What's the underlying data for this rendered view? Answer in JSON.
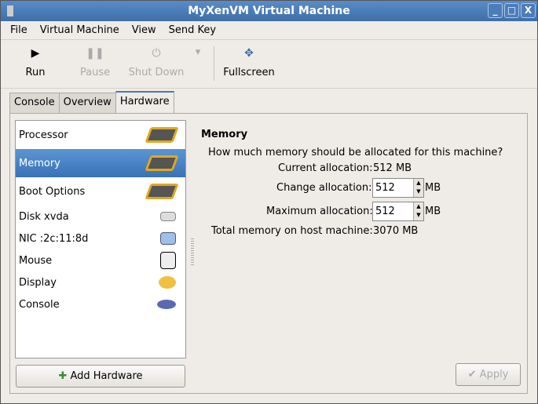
{
  "window": {
    "title": "MyXenVM Virtual Machine",
    "minimize": "_",
    "maximize": "□",
    "close": "X"
  },
  "menu": [
    "File",
    "Virtual Machine",
    "View",
    "Send Key"
  ],
  "toolbar": {
    "run": "Run",
    "pause": "Pause",
    "shutdown": "Shut Down",
    "fullscreen": "Fullscreen"
  },
  "tabs": [
    "Console",
    "Overview",
    "Hardware"
  ],
  "hardware": [
    {
      "label": "Processor",
      "icon": "chip-icon"
    },
    {
      "label": "Memory",
      "icon": "chip-icon"
    },
    {
      "label": "Boot Options",
      "icon": "chip-icon"
    },
    {
      "label": "Disk xvda",
      "icon": "disk-icon"
    },
    {
      "label": "NIC :2c:11:8d",
      "icon": "network-icon"
    },
    {
      "label": "Mouse",
      "icon": "mouse-icon"
    },
    {
      "label": "Display",
      "icon": "palette-icon"
    },
    {
      "label": "Console",
      "icon": "console-icon"
    }
  ],
  "add_hardware": "Add Hardware",
  "memory": {
    "heading": "Memory",
    "question": "How much memory should be allocated for this machine?",
    "current_label": "Current allocation:",
    "current_value": "512 MB",
    "change_label": "Change allocation:",
    "change_value": "512",
    "max_label": "Maximum allocation:",
    "max_value": "512",
    "unit": "MB",
    "total_label": "Total memory on host machine:",
    "total_value": "3070 MB"
  },
  "apply": "Apply"
}
